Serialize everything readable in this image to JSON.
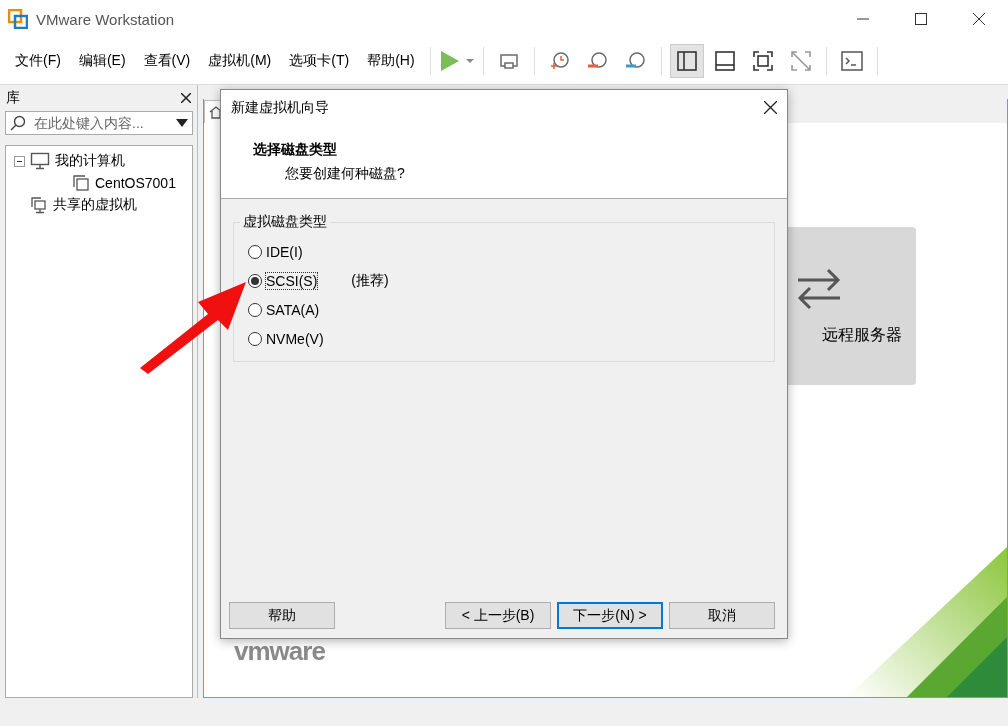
{
  "window": {
    "title": "VMware Workstation"
  },
  "menu": [
    "文件(F)",
    "编辑(E)",
    "查看(V)",
    "虚拟机(M)",
    "选项卡(T)",
    "帮助(H)"
  ],
  "view_buttons": [
    {
      "selected": true
    },
    {
      "selected": false
    },
    {
      "selected": false
    },
    {
      "selected": false
    }
  ],
  "library": {
    "title": "库",
    "search": {
      "placeholder": "在此处键入内容..."
    },
    "tree": [
      {
        "label": "我的计算机",
        "expanded": true,
        "children": [
          {
            "label": "CentOS7001"
          }
        ]
      },
      {
        "label": "共享的虚拟机"
      }
    ]
  },
  "home": {
    "card": {
      "label": "远程服务器"
    },
    "logo": "vmware"
  },
  "dialog": {
    "title": "新建虚拟机向导",
    "heading": "选择磁盘类型",
    "subheading": "您要创建何种磁盘?",
    "group": {
      "title": "虚拟磁盘类型",
      "options": [
        {
          "label": "IDE(I)",
          "selected": false
        },
        {
          "label": "SCSI(S)",
          "selected": true,
          "note": "(推荐)"
        },
        {
          "label": "SATA(A)",
          "selected": false
        },
        {
          "label": "NVMe(V)",
          "selected": false
        }
      ]
    },
    "buttons": [
      {
        "label": "帮助",
        "kind": "plain"
      },
      {
        "label": "< 上一步(B)",
        "kind": "plain"
      },
      {
        "label": "下一步(N) >",
        "kind": "default"
      },
      {
        "label": "取消",
        "kind": "plain"
      }
    ]
  }
}
